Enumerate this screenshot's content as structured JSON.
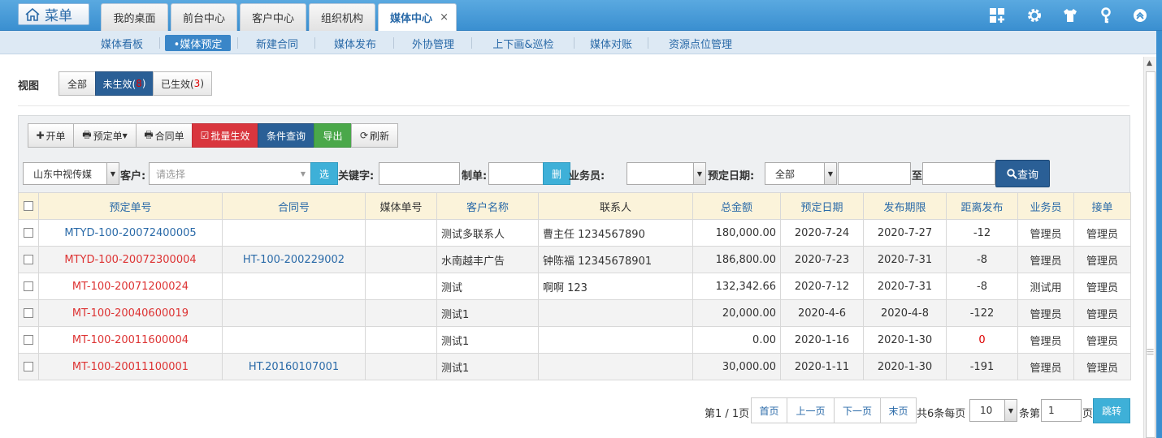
{
  "header": {
    "menu_label": "菜单",
    "tabs": [
      {
        "label": "我的桌面"
      },
      {
        "label": "前台中心"
      },
      {
        "label": "客户中心"
      },
      {
        "label": "组织机构"
      },
      {
        "label": "媒体中心"
      }
    ],
    "close": "×"
  },
  "subnav": {
    "items": [
      "媒体看板",
      "•媒体预定",
      "新建合同",
      "媒体发布",
      "外协管理",
      "上下画&巡检",
      "媒体对账",
      "资源点位管理"
    ]
  },
  "view": {
    "label": "视图",
    "all": "全部",
    "pending_prefix": "未生效(",
    "pending_count": "8",
    "closer": ")",
    "active_prefix": "已生效(",
    "active_count": "3"
  },
  "toolbar": {
    "open": "开单",
    "booking": "预定单",
    "contract": "合同单",
    "batch": "批量生效",
    "condition": "条件查询",
    "export": "导出",
    "refresh": "刷新"
  },
  "filters": {
    "company": "山东中视传媒",
    "customer_label": "客户:",
    "customer_placeholder": "请选择",
    "select_btn": "选",
    "keyword_label": "关键字:",
    "maker_label": "制单:",
    "del_btn": "删",
    "salesman_label": "业务员:",
    "date_label": "预定日期:",
    "date_option": "全部",
    "to_label": "至",
    "query": "查询"
  },
  "table": {
    "headers": [
      "预定单号",
      "合同号",
      "媒体单号",
      "客户名称",
      "联系人",
      "总金额",
      "预定日期",
      "发布期限",
      "距离发布",
      "业务员",
      "接单"
    ],
    "rows": [
      {
        "order": "MTYD-100-20072400005",
        "contract": "",
        "media": "",
        "customer": "测试多联系人",
        "contact": "曹主任 1234567890",
        "amount": "180,000.00",
        "date": "2020-7-24",
        "deadline": "2020-7-27",
        "distance": "-12",
        "sales": "管理员",
        "receiver": "管理员"
      },
      {
        "order": "MTYD-100-20072300004",
        "contract": "HT-100-200229002",
        "media": "",
        "customer": "水南越丰广告",
        "contact": "钟陈福 12345678901",
        "amount": "186,800.00",
        "date": "2020-7-23",
        "deadline": "2020-7-31",
        "distance": "-8",
        "sales": "管理员",
        "receiver": "管理员"
      },
      {
        "order": "MT-100-20071200024",
        "contract": "",
        "media": "",
        "customer": "测试",
        "contact": "啊啊 123",
        "amount": "132,342.66",
        "date": "2020-7-12",
        "deadline": "2020-7-31",
        "distance": "-8",
        "sales": "测试用",
        "receiver": "管理员"
      },
      {
        "order": "MT-100-20040600019",
        "contract": "",
        "media": "",
        "customer": "测试1",
        "contact": "",
        "amount": "20,000.00",
        "date": "2020-4-6",
        "deadline": "2020-4-8",
        "distance": "-122",
        "sales": "管理员",
        "receiver": "管理员"
      },
      {
        "order": "MT-100-20011600004",
        "contract": "",
        "media": "",
        "customer": "测试1",
        "contact": "",
        "amount": "0.00",
        "date": "2020-1-16",
        "deadline": "2020-1-30",
        "distance": "0",
        "sales": "管理员",
        "receiver": "管理员"
      },
      {
        "order": "MT-100-20011100001",
        "contract": "HT.20160107001",
        "media": "",
        "customer": "测试1",
        "contact": "",
        "amount": "30,000.00",
        "date": "2020-1-11",
        "deadline": "2020-1-30",
        "distance": "-191",
        "sales": "管理员",
        "receiver": "管理员"
      }
    ]
  },
  "pager": {
    "page_info": "第1 / 1页",
    "first": "首页",
    "prev": "上一页",
    "next": "下一页",
    "last": "末页",
    "total": "共6条每页",
    "per_page": "10",
    "goto_prefix": "条第",
    "goto_value": "1",
    "page_suffix": "页",
    "jump": "跳转"
  },
  "colors": {
    "accent": "#3a8fd0",
    "active_btn": "#2a5f96",
    "danger": "#d9363e",
    "success": "#4aa84a",
    "info": "#3eb0d8"
  }
}
